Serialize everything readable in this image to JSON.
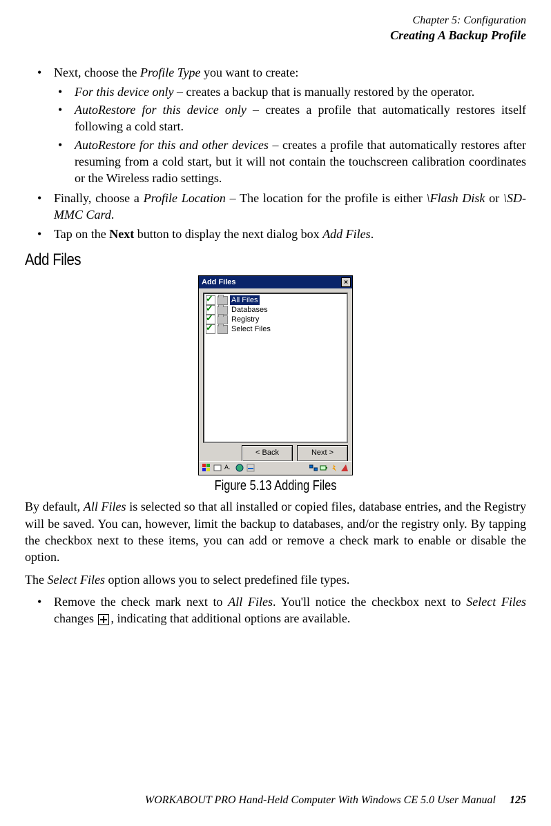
{
  "header": {
    "chapter": "Chapter 5: Configuration",
    "section": "Creating A Backup Profile"
  },
  "bullets": {
    "b1_pre": "Next, choose the ",
    "b1_em": "Profile Type",
    "b1_post": " you want to create:",
    "s1_em": "For this device only",
    "s1_body": " – creates a backup that is manually restored by the operator.",
    "s2_em": "AutoRestore for this device only",
    "s2_body": " – creates a profile that automatically restores itself following a cold start.",
    "s3_em": "AutoRestore for this and other devices",
    "s3_body": " – creates a profile that automati­cally restores after resuming from a cold start, but it will not contain the touchscreen calibration coordinates or the Wireless radio settings.",
    "b2_pre": "Finally, choose a ",
    "b2_em": "Profile Location",
    "b2_mid": " – The location for the profile is either ",
    "b2_em2": "\\Flash Disk",
    "b2_or": " or ",
    "b2_em3": "\\SD-MMC Card",
    "b2_end": ".",
    "b3_pre": "Tap on the ",
    "b3_bold": "Next",
    "b3_mid": " button to display the next dialog box ",
    "b3_em": "Add Files",
    "b3_end": "."
  },
  "heading_add_files": "Add Files",
  "dialog": {
    "title": "Add Files",
    "close": "×",
    "items": [
      {
        "label": "All Files",
        "checked": true,
        "selected": true
      },
      {
        "label": "Databases",
        "checked": true,
        "selected": false
      },
      {
        "label": "Registry",
        "checked": true,
        "selected": false
      },
      {
        "label": "Select Files",
        "checked": true,
        "selected": false
      }
    ],
    "back": "< Back",
    "next": "Next >"
  },
  "figure_caption": "Figure 5.13 Adding Files",
  "para1_pre": "By default, ",
  "para1_em": "All Files",
  "para1_post": " is selected so that all installed or copied files, database entries, and the Registry will be saved. You can, however, limit the backup to databases, and/or the registry only. By tapping the checkbox next to these items, you can add or remove a check mark to enable or disable the option.",
  "para2_pre": "The ",
  "para2_em": "Select Files",
  "para2_post": " option allows you to select predefined file types.",
  "bullet4_pre": "Remove the check mark next to ",
  "bullet4_em1": "All Files",
  "bullet4_mid": ". You'll notice the checkbox next to ",
  "bullet4_em2": "Select Files",
  "bullet4_post1": " changes ",
  "bullet4_post2": ", indicating that additional options are available.",
  "footer": {
    "manual": "WORKABOUT PRO Hand-Held Computer With Windows CE 5.0 User Manual",
    "page": "125"
  }
}
